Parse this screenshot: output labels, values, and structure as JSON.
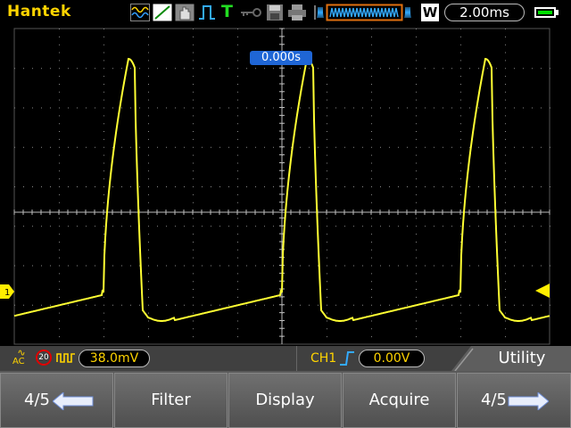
{
  "topbar": {
    "brand": "Hantek",
    "trigger_status": "T",
    "timebase": "2.00ms",
    "mode_letter": "W",
    "icons": [
      "waveform-icon",
      "cursor-line-icon",
      "hand-icon",
      "pulse-icon",
      "trigger-t-icon",
      "key-icon",
      "save-icon",
      "print-icon",
      "memory-bar-icon",
      "battery-icon"
    ]
  },
  "screen": {
    "trigger_position": "0.000s",
    "channel_marker": "1"
  },
  "status": {
    "coupling": "AC",
    "bandwidth": "20",
    "vscale": "38.0mV",
    "trigger_source": "CH1",
    "trigger_level": "0.00V",
    "menu_title": "Utility"
  },
  "softkeys": {
    "page_prev": "4/5",
    "filter": "Filter",
    "display": "Display",
    "acquire": "Acquire",
    "page_next": "4/5"
  },
  "colors": {
    "trace": "#ffff33",
    "brand": "#ffd400",
    "trigger_marker": "#ffee00",
    "accent_blue": "#1f66d6"
  }
}
